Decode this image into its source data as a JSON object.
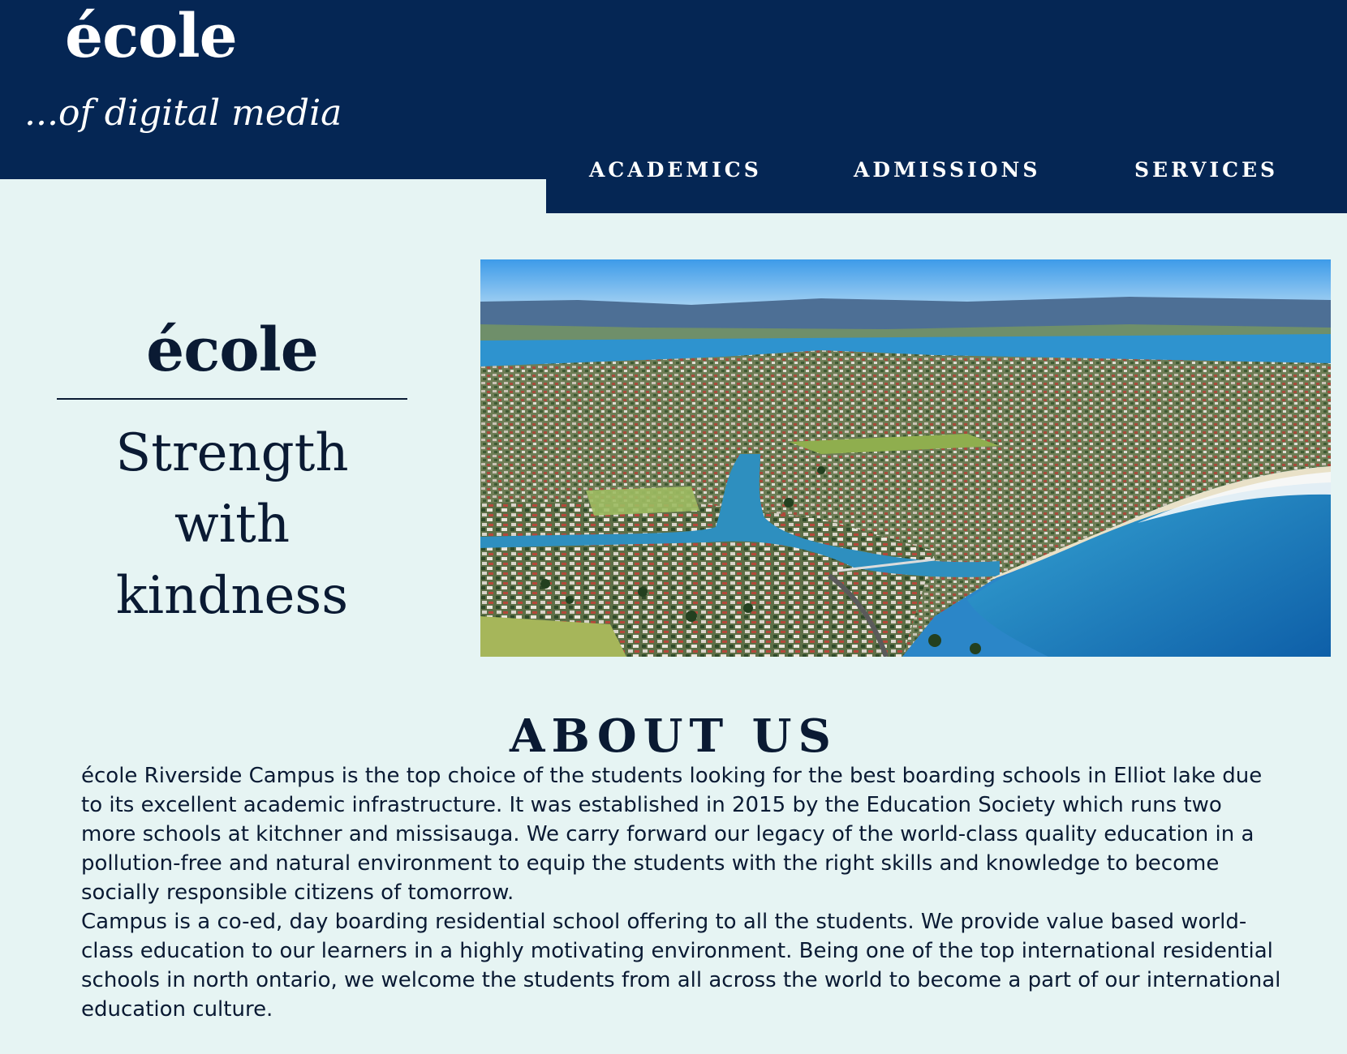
{
  "brand": {
    "logo": "école",
    "tagline": "...of digital media"
  },
  "nav": {
    "items": [
      {
        "label": "ACADEMICS"
      },
      {
        "label": "ADMISSIONS"
      },
      {
        "label": "SERVICES"
      }
    ]
  },
  "hero": {
    "logo": "école",
    "slogan_line1": "Strength with",
    "slogan_line2": "kindness"
  },
  "about": {
    "heading": "ABOUT US",
    "paragraph1": "école Riverside Campus is the top choice of the students looking for the best boarding schools in Elliot lake due to its excellent academic infrastructure. It was established in 2015 by the Education Society which runs two more schools at kitchner and missisauga. We carry forward our legacy of the world-class quality education in a pollution-free and natural environment to equip the students with the right skills and knowledge to become socially responsible citizens of tomorrow.",
    "paragraph2": "Campus is a co-ed, day boarding residential school offering to all the students. We provide value based world-class education to our learners in a highly motivating environment. Being one of the top international residential schools in north ontario, we welcome the students from all across the world to become a part of our international education culture."
  },
  "colors": {
    "header_bg": "#052654",
    "page_bg": "#e6f4f3",
    "text_dark": "#0a1a33"
  }
}
